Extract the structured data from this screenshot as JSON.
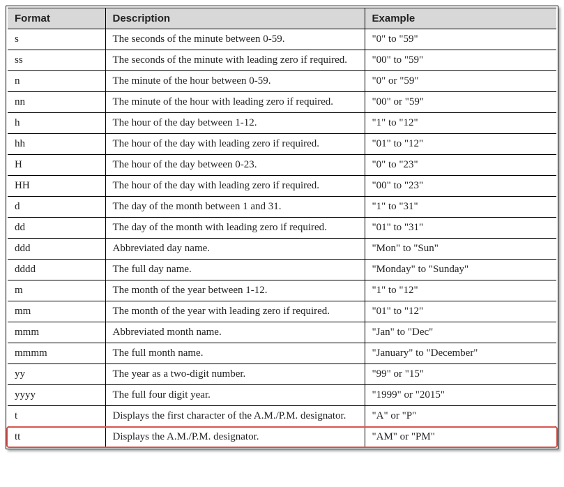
{
  "headers": {
    "col1": "Format",
    "col2": "Description",
    "col3": "Example"
  },
  "rows": [
    {
      "format": "s",
      "description": "The seconds of the minute between 0-59.",
      "example": "\"0\" to \"59\""
    },
    {
      "format": "ss",
      "description": "The seconds of the minute with leading zero if required.",
      "example": "\"00\" to \"59\""
    },
    {
      "format": "n",
      "description": "The minute of the hour between 0-59.",
      "example": "\"0\" or \"59\""
    },
    {
      "format": "nn",
      "description": "The minute of the hour with leading zero if required.",
      "example": "\"00\" or \"59\""
    },
    {
      "format": "h",
      "description": "The hour of the day between 1-12.",
      "example": "\"1\" to \"12\""
    },
    {
      "format": "hh",
      "description": "The hour of the day with leading zero if required.",
      "example": "\"01\" to \"12\""
    },
    {
      "format": "H",
      "description": "The hour of the day between 0-23.",
      "example": "\"0\" to \"23\""
    },
    {
      "format": "HH",
      "description": "The hour of the day with leading zero if required.",
      "example": "\"00\" to \"23\""
    },
    {
      "format": "d",
      "description": "The day of the month between 1 and 31.",
      "example": "\"1\" to \"31\""
    },
    {
      "format": "dd",
      "description": "The day of the month with leading zero if required.",
      "example": "\"01\" to \"31\""
    },
    {
      "format": "ddd",
      "description": "Abbreviated day name.",
      "example": "\"Mon\" to \"Sun\""
    },
    {
      "format": "dddd",
      "description": "The full day name.",
      "example": "\"Monday\" to \"Sunday\""
    },
    {
      "format": "m",
      "description": "The month of the year between 1-12.",
      "example": "\"1\" to \"12\""
    },
    {
      "format": "mm",
      "description": "The month of the year with leading zero if required.",
      "example": "\"01\" to \"12\""
    },
    {
      "format": "mmm",
      "description": "Abbreviated month name.",
      "example": "\"Jan\" to \"Dec\""
    },
    {
      "format": "mmmm",
      "description": "The full month name.",
      "example": "\"January\" to \"December\""
    },
    {
      "format": "yy",
      "description": "The year as a two-digit number.",
      "example": "\"99\" or \"15\""
    },
    {
      "format": "yyyy",
      "description": "The full four digit year.",
      "example": "\"1999\" or \"2015\""
    },
    {
      "format": "t",
      "description": "Displays the first character of the A.M./P.M. designator.",
      "example": "\"A\" or \"P\""
    },
    {
      "format": "tt",
      "description": "Displays the A.M./P.M. designator.",
      "example": "\"AM\" or \"PM\""
    }
  ],
  "highlighted_row_index": 19
}
